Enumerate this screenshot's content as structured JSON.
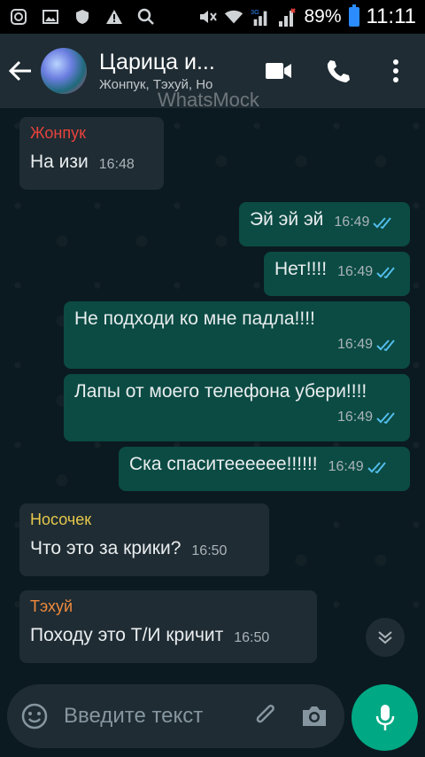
{
  "status_bar": {
    "battery_percent": "89%",
    "time": "11:11",
    "network": "3G"
  },
  "header": {
    "title": "Царица и...",
    "subtitle": "Жонпук, Тэхуй, Но"
  },
  "watermark": "WhatsMock",
  "messages": [
    {
      "direction": "in",
      "sender": "Жонпук",
      "sender_color": "#e8423c",
      "text": "На изи",
      "time": "16:48"
    },
    {
      "direction": "out",
      "text": "Эй эй эй",
      "time": "16:49"
    },
    {
      "direction": "out",
      "text": "Нет!!!!",
      "time": "16:49"
    },
    {
      "direction": "out",
      "text": "Не подходи ко мне падла!!!!",
      "time": "16:49"
    },
    {
      "direction": "out",
      "text": "Лапы от моего телефона убери!!!!",
      "time": "16:49"
    },
    {
      "direction": "out",
      "text": "Ска спаситееееее!!!!!!",
      "time": "16:49"
    },
    {
      "direction": "in",
      "sender": "Носочек",
      "sender_color": "#e6c84b",
      "text": "Что это за крики?",
      "time": "16:50"
    },
    {
      "direction": "in",
      "sender": "Тэхуй",
      "sender_color": "#f08a3c",
      "text": "Походу это Т/И кричит",
      "time": "16:50"
    }
  ],
  "input": {
    "placeholder": "Введите текст"
  },
  "colors": {
    "accent": "#00a884",
    "read_ticks": "#53bdeb",
    "header_bg": "#1f2c33",
    "outgoing_bubble": "#0b4b43"
  }
}
